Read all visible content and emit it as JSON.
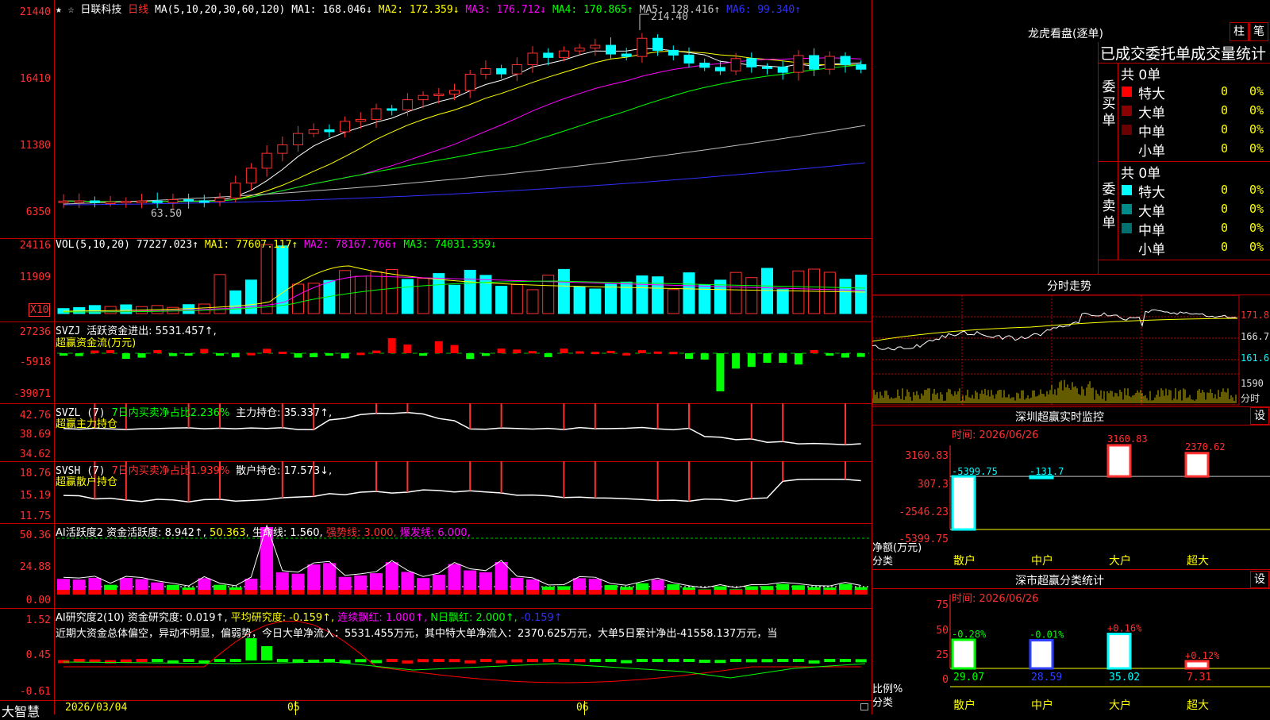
{
  "header": {
    "star": "★ ☆",
    "stock_name": "日联科技",
    "period": "日线",
    "ma_prefix": "MA(5,10,20,30,60,120)",
    "ma1": "MA1: 168.046↓",
    "ma2": "MA2: 172.359↓",
    "ma3": "MA3: 176.712↓",
    "ma4": "MA4: 170.865↑",
    "ma5": "MA5: 128.416↑",
    "ma6": "MA6: 99.340↑"
  },
  "price_axis": [
    "21440",
    "16410",
    "11380",
    "6350"
  ],
  "price_annotations": {
    "high": "214.40",
    "low": "63.50"
  },
  "vol": {
    "title": "VOL(5,10,20)",
    "value": "77227.023↑",
    "ma1": "MA1: 77607.117↑",
    "ma2": "MA2: 78167.766↑",
    "ma3": "MA3: 74031.359↓",
    "axis": [
      "24116",
      "11909"
    ],
    "unit_badge": "X10"
  },
  "svzj": {
    "title": "SVZJ",
    "line1": "活跃资金进出: 5531.457↑,",
    "line2": "超赢资金流(万元)",
    "axis": [
      "27236",
      "-5918",
      "-39071"
    ]
  },
  "svzl": {
    "title": "SVZL (7)",
    "ratio": "7日内买卖净占比2.236%",
    "hold": "主力持仓: 35.337↑,",
    "line2": "超赢主力持仓",
    "axis": [
      "42.76",
      "38.69",
      "34.62"
    ]
  },
  "svsh": {
    "title": "SVSH (7)",
    "ratio": "7日内买卖净占比1.939%",
    "hold": "散户持仓: 17.573↓,",
    "line2": "超赢散户持仓",
    "axis": [
      "18.76",
      "15.19",
      "11.75"
    ]
  },
  "ai_active": {
    "title": "AI活跃度2",
    "a": "资金活跃度: 8.942↑,",
    "b": "50.363,",
    "c": "生命线: 1.560,",
    "d": "强势线: 3.000,",
    "e": "爆发线: 6.000,",
    "axis": [
      "50.36",
      "24.88",
      "0.00"
    ]
  },
  "ai_research": {
    "title": "AI研究度2(10)",
    "a": "资金研究度: 0.019↑,",
    "b": "平均研究度: -0.159↑,",
    "c": "连续飘红: 1.000↑,",
    "d": "N日飘红: 2.000↑,",
    "e": "-0.159↑",
    "summary": "近期大资金总体偏空，异动不明显，偏弱势，今日大单净流入：5531.455万元，其中特大单净流入：2370.625万元，大单5日累计净出-41558.137万元，当",
    "axis": [
      "1.52",
      "0.45",
      "-0.61"
    ]
  },
  "footer": {
    "brand": "大智慧",
    "date": "2026/03/04",
    "m05": "05",
    "m06": "06"
  },
  "longhu": {
    "title": "龙虎看盘(逐单)",
    "btn_bar": "柱",
    "btn_pen": "笔",
    "subtitle": "已成交委托单成交量统计",
    "buy": {
      "label": "委买单",
      "total": "共 0单",
      "rows": [
        {
          "name": "特大",
          "count": "0",
          "pct": "0%",
          "color": "#ff0000"
        },
        {
          "name": "大单",
          "count": "0",
          "pct": "0%",
          "color": "#8b0000"
        },
        {
          "name": "中单",
          "count": "0",
          "pct": "0%",
          "color": "#6a0000"
        },
        {
          "name": "小单",
          "count": "0",
          "pct": "0%",
          "color": ""
        }
      ]
    },
    "sell": {
      "label": "委卖单",
      "total": "共 0单",
      "rows": [
        {
          "name": "特大",
          "count": "0",
          "pct": "0%",
          "color": "#00ffff"
        },
        {
          "name": "大单",
          "count": "0",
          "pct": "0%",
          "color": "#008b8b"
        },
        {
          "name": "中单",
          "count": "0",
          "pct": "0%",
          "color": "#007070"
        },
        {
          "name": "小单",
          "count": "0",
          "pct": "0%",
          "color": ""
        }
      ]
    }
  },
  "intraday": {
    "title": "分时走势",
    "axis": [
      "171.8",
      "166.7",
      "161.6"
    ],
    "vol_axis": "1590",
    "vol_label": "分时"
  },
  "sz_monitor": {
    "title": "深圳超赢实时监控",
    "btn": "设",
    "time": "时间: 2026/06/26",
    "axis": [
      "3160.83",
      "307.3",
      "-2546.23",
      "-5399.75"
    ],
    "ylabel": "净额(万元)",
    "xlabel": "分类",
    "bars": [
      {
        "cat": "散户",
        "value": -5399.75,
        "label": "-5399.75",
        "color": "#00ffff"
      },
      {
        "cat": "中户",
        "value": -131.7,
        "label": "-131.7",
        "color": "#00ffff"
      },
      {
        "cat": "大户",
        "value": 3160.83,
        "label": "3160.83",
        "color": "#ff3030"
      },
      {
        "cat": "超大",
        "value": 2370.62,
        "label": "2370.62",
        "color": "#ff3030"
      }
    ]
  },
  "sz_classify": {
    "title": "深市超赢分类统计",
    "btn": "设",
    "time": "时间: 2026/06/26",
    "axis": [
      "75",
      "50",
      "25",
      "0"
    ],
    "ylabel": "比例%",
    "xlabel": "分类",
    "bars": [
      {
        "cat": "散户",
        "value": 29.07,
        "label": "29.07",
        "change": "-0.28%",
        "color": "#00ff00"
      },
      {
        "cat": "中户",
        "value": 28.59,
        "label": "28.59",
        "change": "-0.01%",
        "color": "#3040ff"
      },
      {
        "cat": "大户",
        "value": 35.02,
        "label": "35.02",
        "change": "+0.16%",
        "color": "#00ffff"
      },
      {
        "cat": "超大",
        "value": 7.31,
        "label": "7.31",
        "change": "+0.12%",
        "color": "#ff3030"
      }
    ]
  }
}
